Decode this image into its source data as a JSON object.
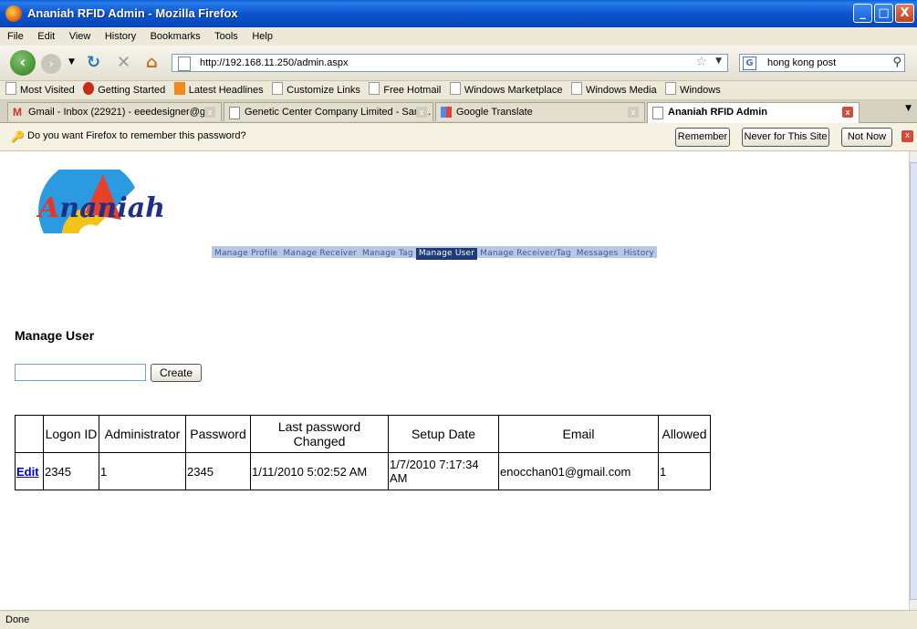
{
  "window": {
    "title": "Ananiah RFID Admin - Mozilla Firefox",
    "btn_min": "_",
    "btn_max": "□",
    "btn_close": "X"
  },
  "menu": [
    "File",
    "Edit",
    "View",
    "History",
    "Bookmarks",
    "Tools",
    "Help"
  ],
  "nav": {
    "url": "http://192.168.11.250/admin.aspx",
    "search_value": "hong kong post"
  },
  "bookmarks": [
    "Most Visited",
    "Getting Started",
    "Latest Headlines",
    "Customize Links",
    "Free Hotmail",
    "Windows Marketplace",
    "Windows Media",
    "Windows"
  ],
  "tabs": [
    {
      "label": "Gmail - Inbox (22921) - eeedesigner@g..."
    },
    {
      "label": "Genetic Center Company Limited - Sam..."
    },
    {
      "label": "Google Translate"
    },
    {
      "label": "Ananiah RFID Admin"
    }
  ],
  "password_bar": {
    "message": "Do you want Firefox to remember this password?",
    "remember": "Remember",
    "never": "Never for This Site",
    "not_now": "Not Now"
  },
  "logo": {
    "letter": "A",
    "rest": "naniah"
  },
  "site_nav": [
    "Manage Profile",
    "Manage Receiver",
    "Manage Tag",
    "Manage User",
    "Manage Receiver/Tag",
    "Messages",
    "History"
  ],
  "site_nav_active": "Manage User",
  "page": {
    "heading": "Manage User",
    "input_value": "",
    "create_label": "Create"
  },
  "table": {
    "headers": [
      "",
      "Logon ID",
      "Administrator",
      "Password",
      "Last password Changed",
      "Setup Date",
      "Email",
      "Allowed"
    ],
    "rows": [
      {
        "action": "Edit",
        "logon_id": "2345",
        "administrator": "1",
        "password": "2345",
        "last_changed": "1/11/2010 5:02:52 AM",
        "setup_date": "1/7/2010 7:17:34 AM",
        "email": "enocchan01@gmail.com",
        "allowed": "1"
      }
    ]
  },
  "status": "Done"
}
